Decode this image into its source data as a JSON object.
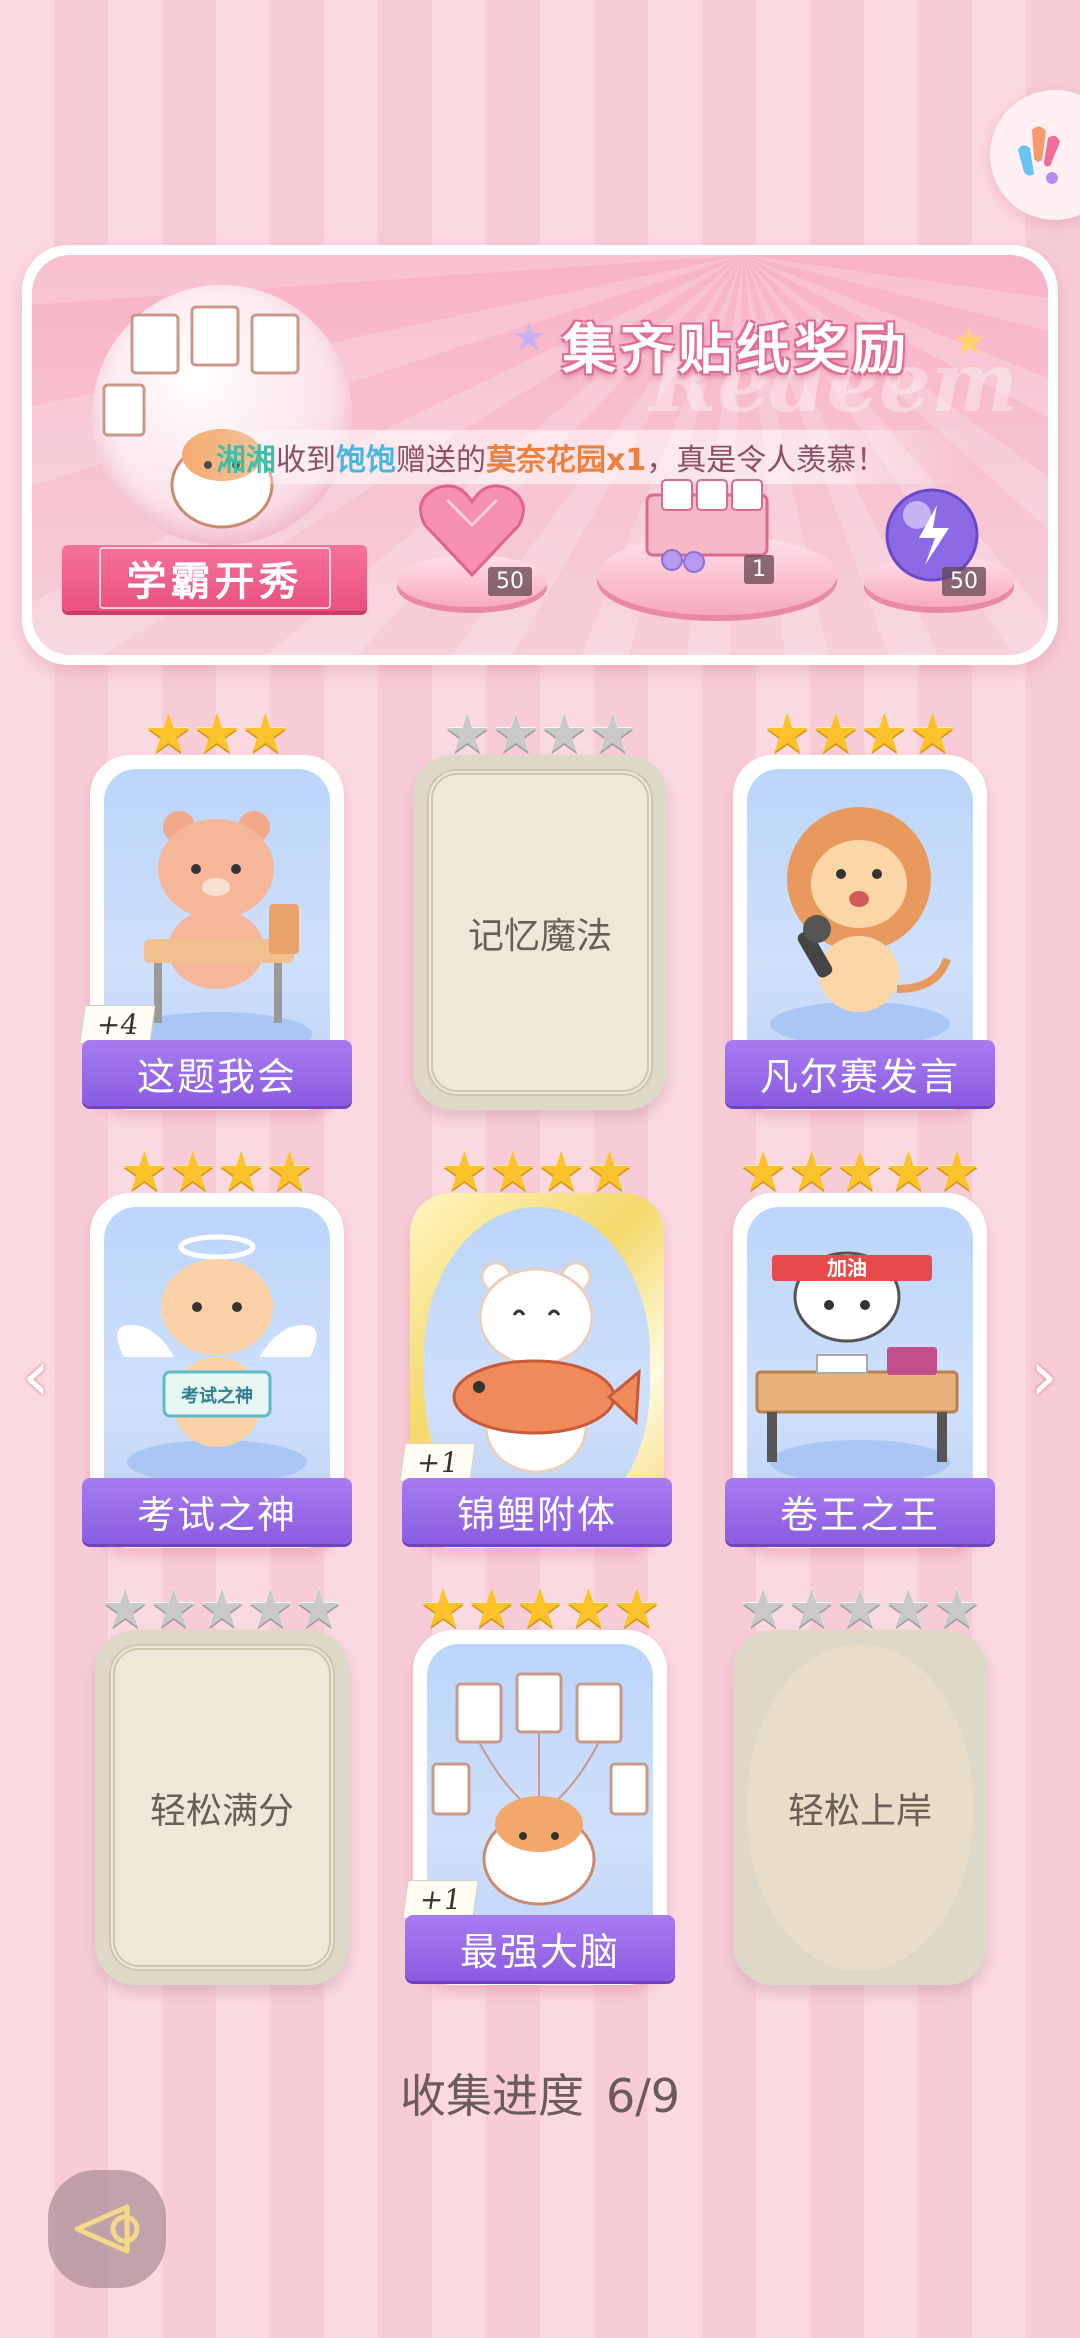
{
  "banner": {
    "title": "集齐贴纸奖励",
    "watermark": "Redeem",
    "marquee": {
      "name1": "湘湘",
      "text1": "收到",
      "name2": "饱饱",
      "text2": "赠送的",
      "item": "莫奈花园x1",
      "text3": "，真是令人羡慕！"
    },
    "album_name": "学霸开秀",
    "rewards": [
      {
        "icon": "pink-heart-gem-icon",
        "count": "50"
      },
      {
        "icon": "gift-box-set-icon",
        "count": "1"
      },
      {
        "icon": "purple-energy-orb-icon",
        "count": "50"
      }
    ]
  },
  "cards": [
    {
      "label": "这题我会",
      "stars": 3,
      "max_stars": 3,
      "collected": true,
      "duplicates": "+4",
      "art": "bear-at-desk"
    },
    {
      "label": "记忆魔法",
      "stars": 0,
      "max_stars": 4,
      "collected": false,
      "duplicates": "",
      "art": "locked"
    },
    {
      "label": "凡尔赛发言",
      "stars": 4,
      "max_stars": 4,
      "collected": true,
      "duplicates": "",
      "art": "lion-with-microphone"
    },
    {
      "label": "考试之神",
      "stars": 4,
      "max_stars": 4,
      "collected": true,
      "duplicates": "",
      "art": "angel-cat",
      "sign": "考试之神"
    },
    {
      "label": "锦鲤附体",
      "stars": 4,
      "max_stars": 4,
      "collected": true,
      "duplicates": "+1",
      "art": "bear-with-koi",
      "gold": true
    },
    {
      "label": "卷王之王",
      "stars": 5,
      "max_stars": 5,
      "collected": true,
      "duplicates": "",
      "art": "cat-with-headband",
      "headband": "加油"
    },
    {
      "label": "轻松满分",
      "stars": 0,
      "max_stars": 5,
      "collected": false,
      "duplicates": "",
      "art": "locked"
    },
    {
      "label": "最强大脑",
      "stars": 5,
      "max_stars": 5,
      "collected": true,
      "duplicates": "+1",
      "art": "cat-with-papers"
    },
    {
      "label": "轻松上岸",
      "stars": 0,
      "max_stars": 5,
      "collected": false,
      "duplicates": "",
      "art": "locked",
      "gold": true
    }
  ],
  "progress": {
    "label": "收集进度",
    "value": "6/9"
  }
}
